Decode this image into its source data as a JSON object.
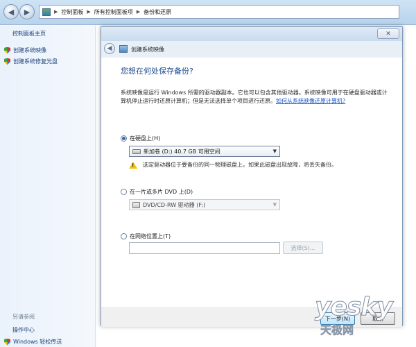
{
  "address_bar": {
    "crumbs": [
      "控制面板",
      "所有控制面板项",
      "备份和还原"
    ]
  },
  "sidebar": {
    "home": "控制面板主页",
    "links": [
      "创建系统映像",
      "创建系统修复光盘"
    ],
    "see_also": "另请参阅",
    "see_also_links": [
      "操作中心",
      "Windows 轻松传送"
    ]
  },
  "dialog": {
    "title": "创建系统映像",
    "question": "您想在何处保存备份?",
    "description": "系统映像是运行 Windows 所需的驱动器副本。它也可以包含其他驱动器。系统映像可用于在硬盘驱动器或计算机停止运行时还原计算机；但是无法选择单个项目进行还原。",
    "description_link": "如何从系统映像还原计算机?",
    "hdd_option": "在硬盘上(H)",
    "hdd_selected": "新加卷 (D:)  40.7 GB 可用空间",
    "warning": "选定驱动器位于要备份的同一物理磁盘上。如果此磁盘出现故障，将丢失备份。",
    "dvd_option": "在一片或多片 DVD 上(D)",
    "dvd_selected": "DVD/CD-RW 驱动器 (F:)",
    "network_option": "在网络位置上(T)",
    "network_value": "",
    "browse_label": "选择(S)...",
    "next_label": "下一步(N)",
    "cancel_label": "取消"
  },
  "watermark": {
    "main": "yesky",
    "sub": "天极网"
  },
  "colors": {
    "accent": "#1d4b8f",
    "link": "#1a56c8",
    "warning": "#f2c200"
  }
}
